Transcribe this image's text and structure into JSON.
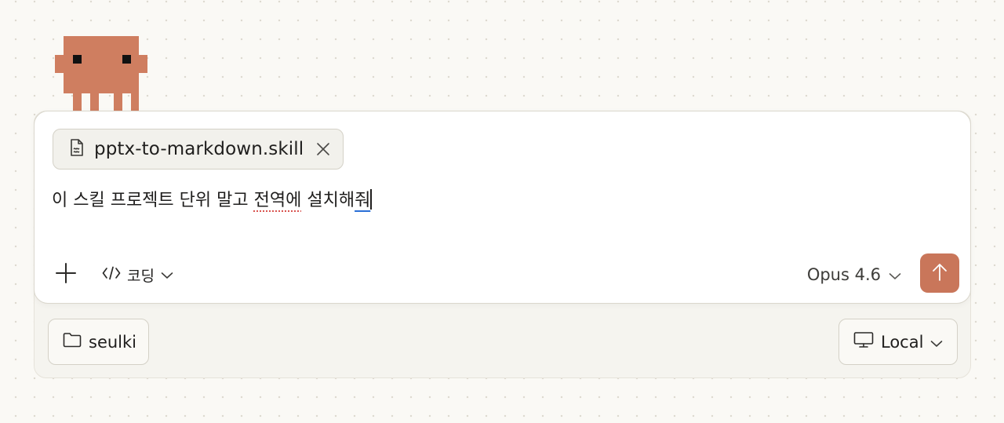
{
  "mascot": {
    "icon": "pixel-creature-icon",
    "color": "#cf7e60"
  },
  "composer": {
    "attachment": {
      "filename": "pptx-to-markdown.skill",
      "icon": "file-icon",
      "remove_icon": "close-icon"
    },
    "prompt": {
      "before": "이 스킬 프로젝트 단위 말고 ",
      "misspelled": "전역에",
      "middle": " 설치해",
      "composing": "줘"
    },
    "toolbar": {
      "add_icon": "plus-icon",
      "mode": {
        "icon": "code-icon",
        "label": "코딩",
        "chevron": "chevron-down-icon"
      },
      "model": {
        "label": "Opus 4.6",
        "chevron": "chevron-down-icon"
      },
      "send": {
        "icon": "arrow-up-icon",
        "color": "#c9765a"
      }
    }
  },
  "footer": {
    "folder": {
      "icon": "folder-icon",
      "label": "seulki"
    },
    "environment": {
      "icon": "monitor-icon",
      "label": "Local",
      "chevron": "chevron-down-icon"
    }
  }
}
